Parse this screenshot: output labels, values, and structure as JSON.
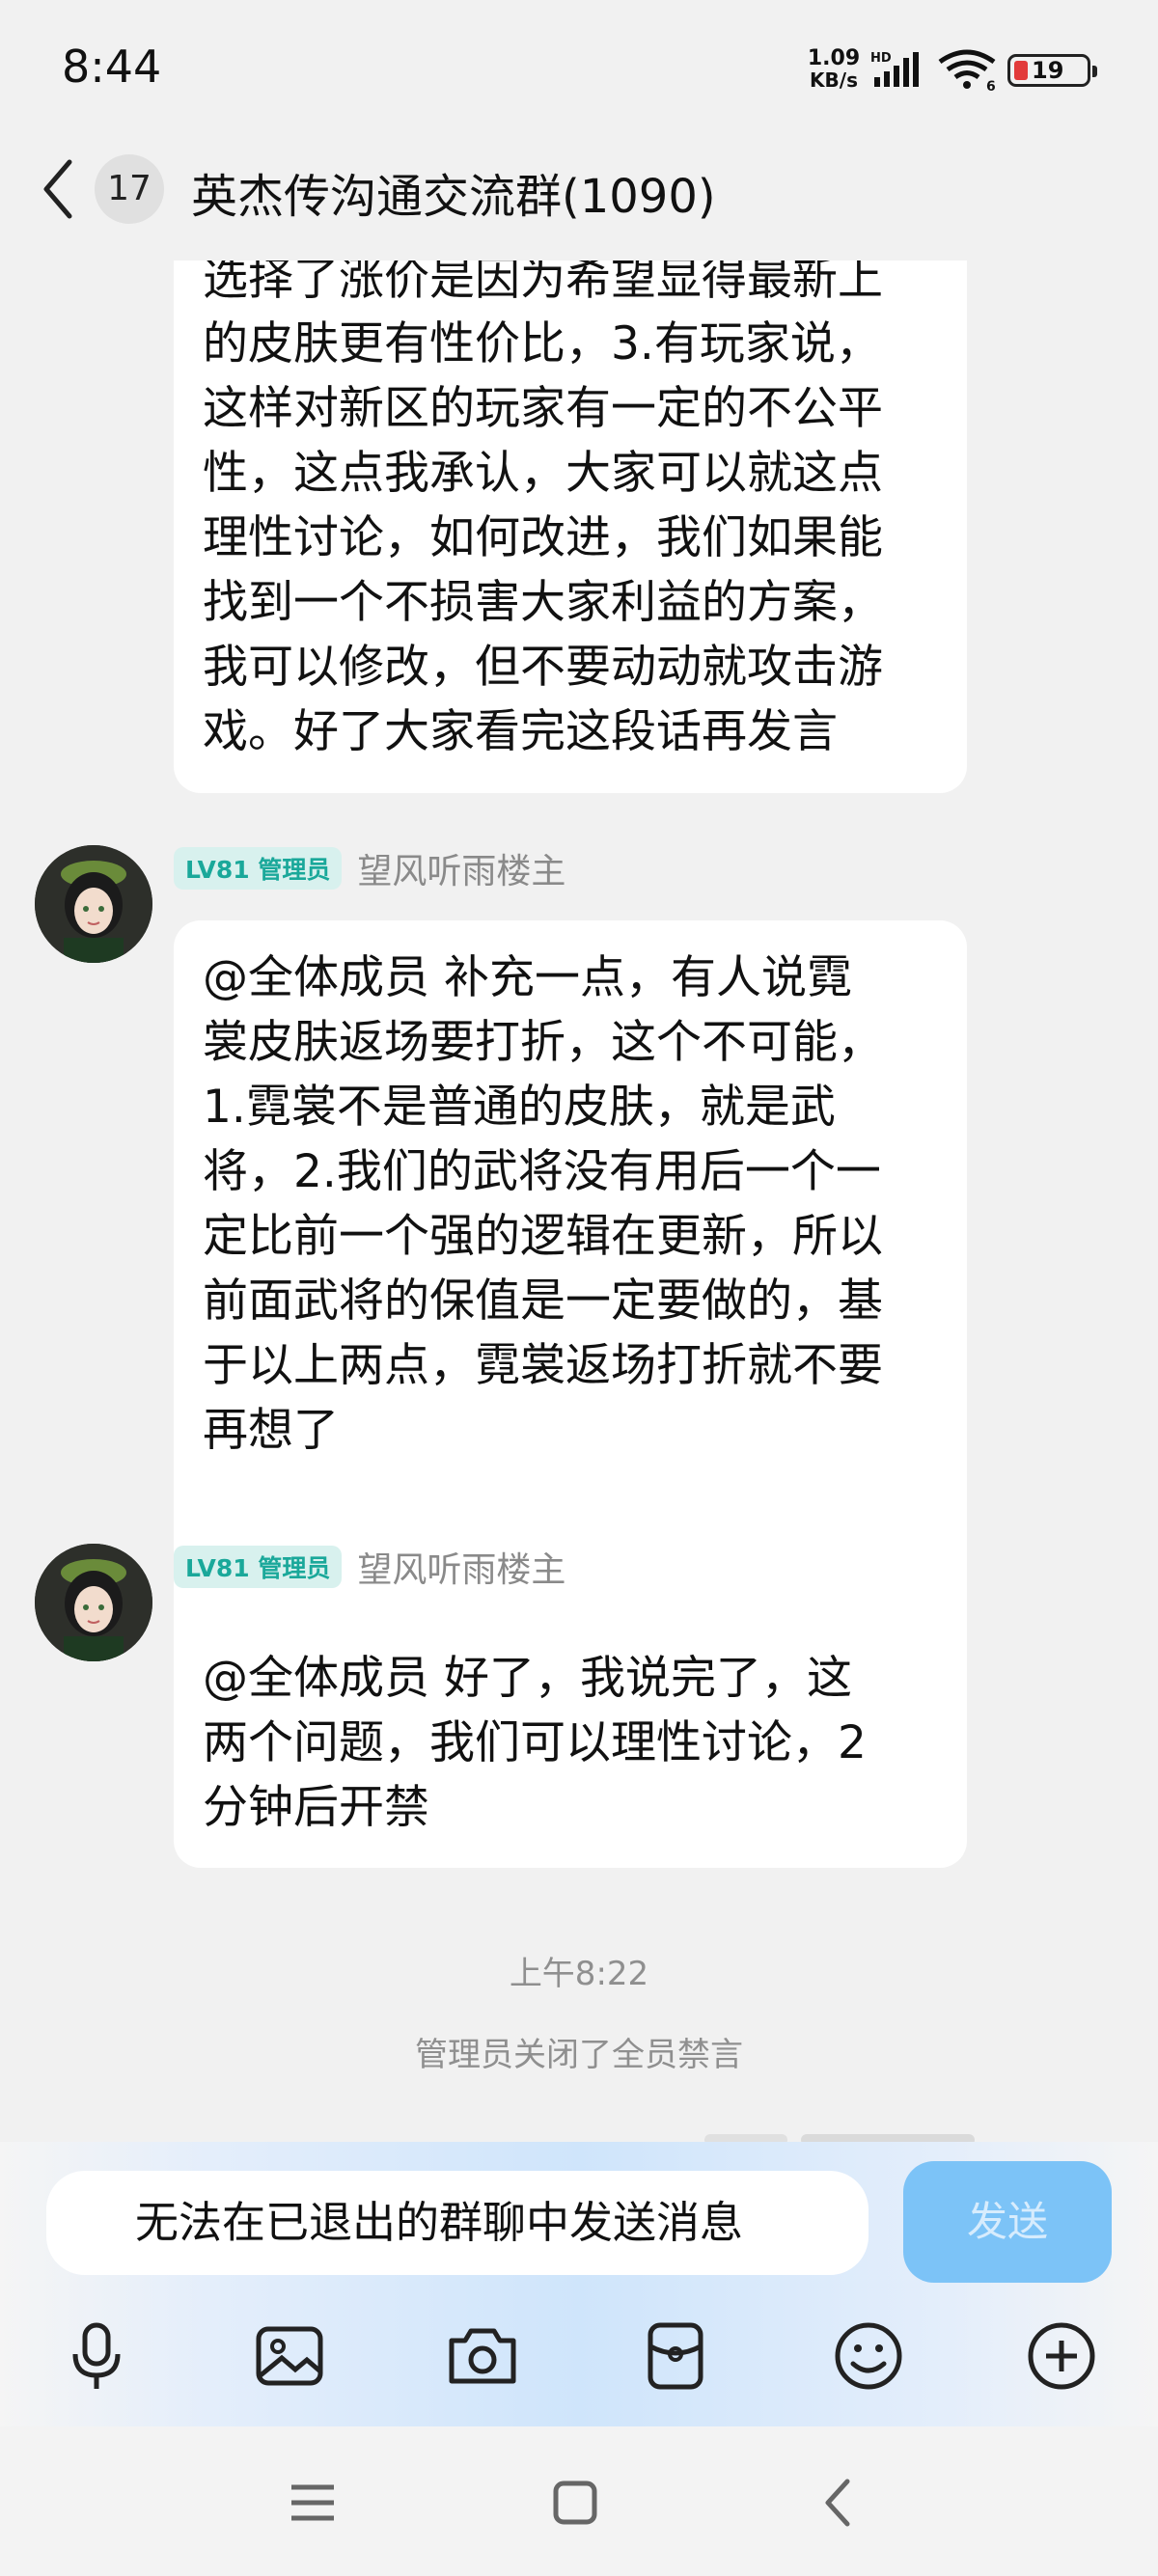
{
  "status_bar": {
    "time": "8:44",
    "net_speed_value": "1.09",
    "net_speed_unit": "KB/s",
    "network_type": "HD",
    "wifi_label": "6",
    "battery_level": "19",
    "battery_color": "#e23b3b"
  },
  "header": {
    "unread_count": "17",
    "title": "英杰传沟通交流群(1090)"
  },
  "messages": [
    {
      "lines": [
        "选择了涨价是因为希望显得最新上",
        "的皮肤更有性价比，3.有玩家说，",
        "这样对新区的玩家有一定的不公平",
        "性，这点我承认，大家可以就这点",
        "理性讨论，如何改进，我们如果能",
        "找到一个不损害大家利益的方案，",
        "我可以修改，但不要动动就攻击游",
        "戏。好了大家看完这段话再发言"
      ]
    },
    {
      "level_badge": "LV81 管理员",
      "sender": "望风听雨楼主",
      "lines": [
        "@全体成员 补充一点，有人说霓",
        "裳皮肤返场要打折，这个不可能，",
        "1.霓裳不是普通的皮肤，就是武",
        "将，2.我们的武将没有用后一个一",
        "定比前一个强的逻辑在更新，所以",
        "前面武将的保值是一定要做的，基",
        "于以上两点，霓裳返场打折就不要",
        "再想了"
      ]
    },
    {
      "level_badge": "LV81 管理员",
      "sender": "望风听雨楼主",
      "lines": [
        "@全体成员 好了，我说完了，这",
        "两个问题，我们可以理性讨论，2",
        "分钟后开禁"
      ]
    }
  ],
  "timestamp": "上午8:22",
  "system_message": "管理员关闭了全员禁言",
  "input": {
    "placeholder": "无法在已退出的群聊中发送消息",
    "send_label": "发送"
  },
  "toolbar_icons": [
    "microphone-icon",
    "image-icon",
    "camera-icon",
    "red-packet-icon",
    "emoji-icon",
    "plus-icon"
  ],
  "nav_icons": [
    "menu-icon",
    "home-icon",
    "back-icon"
  ],
  "colors": {
    "accent": "#1aa89a",
    "send_button": "#7cc3f7",
    "background": "#f1f1f1"
  }
}
